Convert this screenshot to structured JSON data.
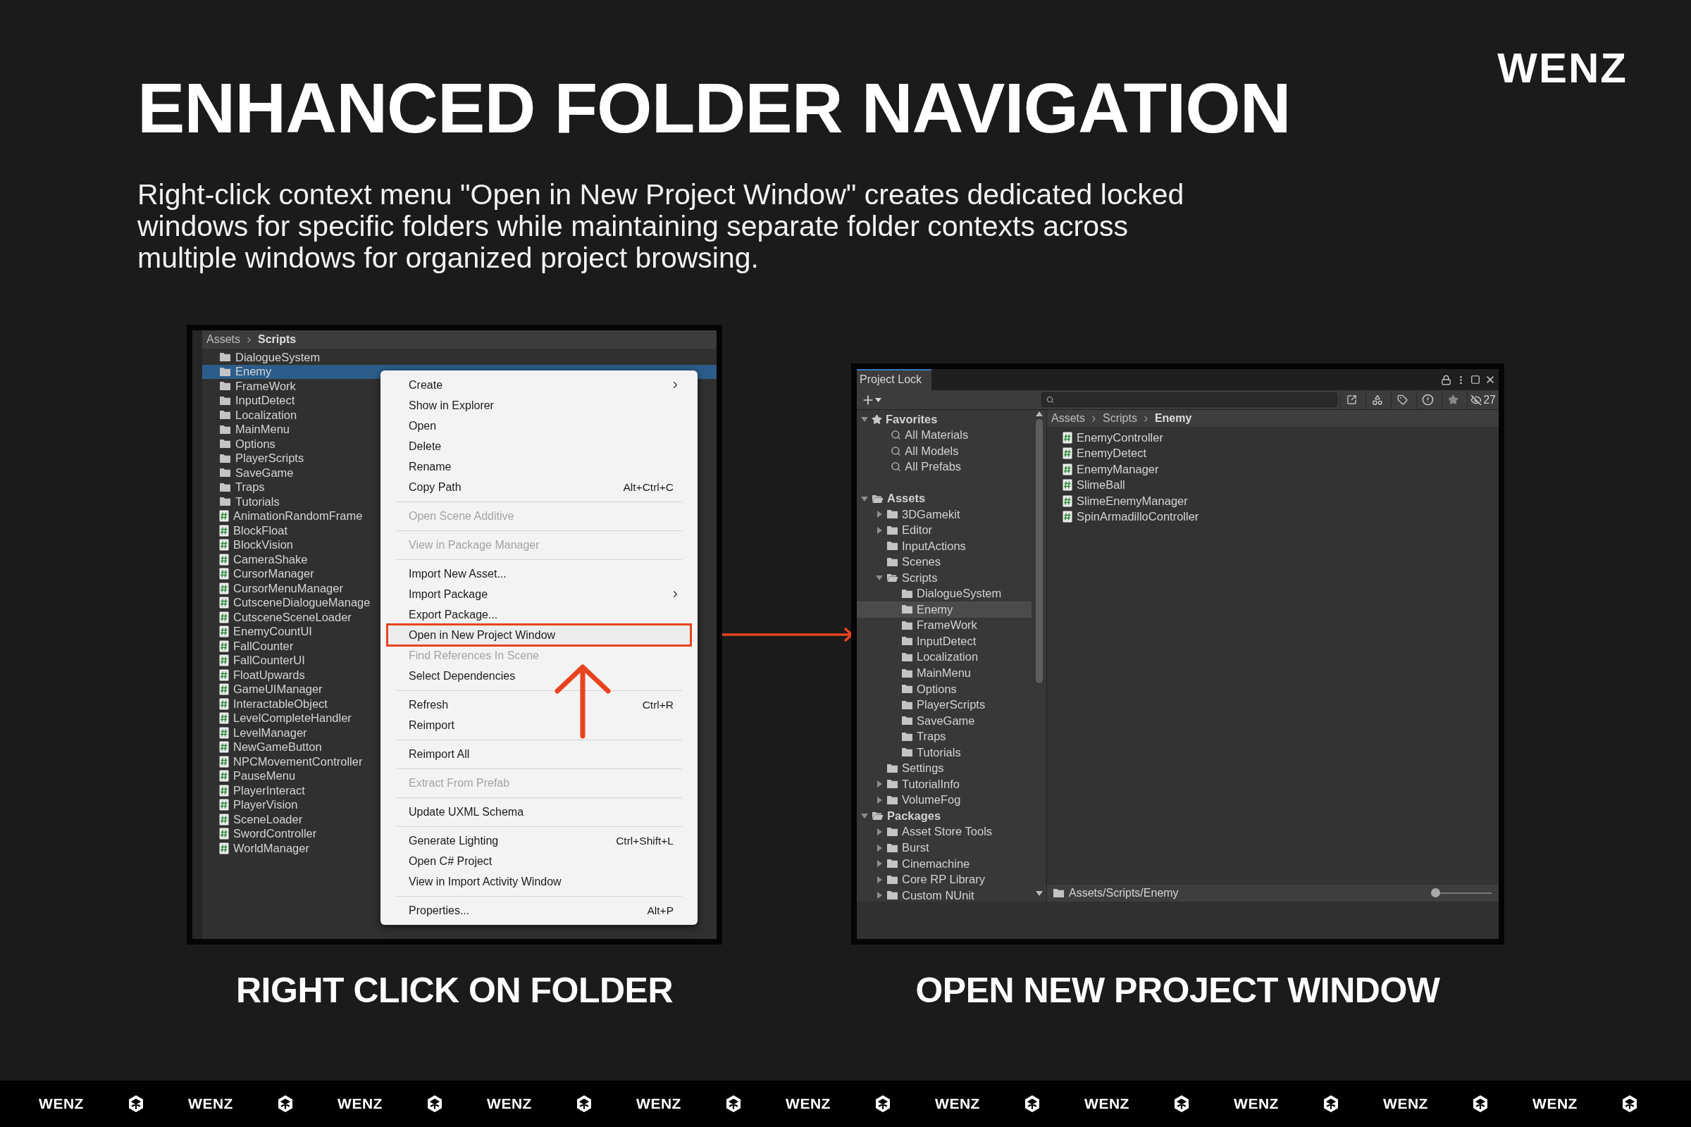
{
  "header": {
    "title": "ENHANCED FOLDER NAVIGATION",
    "description": "Right-click context menu \"Open in New Project Window\" creates dedicated locked windows for specific folders while maintaining separate folder contexts across multiple windows for organized project browsing.",
    "logo": "WENZ"
  },
  "left_panel": {
    "breadcrumb": [
      "Assets",
      "Scripts"
    ],
    "items": [
      {
        "name": "DialogueSystem",
        "kind": "folder",
        "selected": false
      },
      {
        "name": "Enemy",
        "kind": "folder",
        "selected": true
      },
      {
        "name": "FrameWork",
        "kind": "folder",
        "selected": false
      },
      {
        "name": "InputDetect",
        "kind": "folder",
        "selected": false
      },
      {
        "name": "Localization",
        "kind": "folder",
        "selected": false
      },
      {
        "name": "MainMenu",
        "kind": "folder",
        "selected": false
      },
      {
        "name": "Options",
        "kind": "folder",
        "selected": false
      },
      {
        "name": "PlayerScripts",
        "kind": "folder",
        "selected": false
      },
      {
        "name": "SaveGame",
        "kind": "folder",
        "selected": false
      },
      {
        "name": "Traps",
        "kind": "folder",
        "selected": false
      },
      {
        "name": "Tutorials",
        "kind": "folder",
        "selected": false
      },
      {
        "name": "AnimationRandomFrame",
        "kind": "script",
        "selected": false
      },
      {
        "name": "BlockFloat",
        "kind": "script",
        "selected": false
      },
      {
        "name": "BlockVision",
        "kind": "script",
        "selected": false
      },
      {
        "name": "CameraShake",
        "kind": "script",
        "selected": false
      },
      {
        "name": "CursorManager",
        "kind": "script",
        "selected": false
      },
      {
        "name": "CursorMenuManager",
        "kind": "script",
        "selected": false
      },
      {
        "name": "CutsceneDialogueManage",
        "kind": "script",
        "selected": false
      },
      {
        "name": "CutsceneSceneLoader",
        "kind": "script",
        "selected": false
      },
      {
        "name": "EnemyCountUI",
        "kind": "script",
        "selected": false
      },
      {
        "name": "FallCounter",
        "kind": "script",
        "selected": false
      },
      {
        "name": "FallCounterUI",
        "kind": "script",
        "selected": false
      },
      {
        "name": "FloatUpwards",
        "kind": "script",
        "selected": false
      },
      {
        "name": "GameUIManager",
        "kind": "script",
        "selected": false
      },
      {
        "name": "InteractableObject",
        "kind": "script",
        "selected": false
      },
      {
        "name": "LevelCompleteHandler",
        "kind": "script",
        "selected": false
      },
      {
        "name": "LevelManager",
        "kind": "script",
        "selected": false
      },
      {
        "name": "NewGameButton",
        "kind": "script",
        "selected": false
      },
      {
        "name": "NPCMovementController",
        "kind": "script",
        "selected": false
      },
      {
        "name": "PauseMenu",
        "kind": "script",
        "selected": false
      },
      {
        "name": "PlayerInteract",
        "kind": "script",
        "selected": false
      },
      {
        "name": "PlayerVision",
        "kind": "script",
        "selected": false
      },
      {
        "name": "SceneLoader",
        "kind": "script",
        "selected": false
      },
      {
        "name": "SwordController",
        "kind": "script",
        "selected": false
      },
      {
        "name": "WorldManager",
        "kind": "script",
        "selected": false
      }
    ],
    "context_menu": [
      [
        {
          "label": "Create",
          "disabled": false,
          "submenu": true,
          "highlighted": false
        },
        {
          "label": "Show in Explorer",
          "disabled": false,
          "submenu": false,
          "highlighted": false
        },
        {
          "label": "Open",
          "disabled": false,
          "submenu": false,
          "highlighted": false
        },
        {
          "label": "Delete",
          "disabled": false,
          "submenu": false,
          "highlighted": false
        },
        {
          "label": "Rename",
          "disabled": false,
          "submenu": false,
          "highlighted": false
        },
        {
          "label": "Copy Path",
          "shortcut": "Alt+Ctrl+C",
          "disabled": false,
          "submenu": false,
          "highlighted": false
        }
      ],
      [
        {
          "label": "Open Scene Additive",
          "disabled": true,
          "submenu": false,
          "highlighted": false
        }
      ],
      [
        {
          "label": "View in Package Manager",
          "disabled": true,
          "submenu": false,
          "highlighted": false
        }
      ],
      [
        {
          "label": "Import New Asset...",
          "disabled": false,
          "submenu": false,
          "highlighted": false
        },
        {
          "label": "Import Package",
          "disabled": false,
          "submenu": true,
          "highlighted": false
        },
        {
          "label": "Export Package...",
          "disabled": false,
          "submenu": false,
          "highlighted": false
        },
        {
          "label": "Open in New Project Window",
          "disabled": false,
          "submenu": false,
          "highlighted": true
        },
        {
          "label": "Find References In Scene",
          "disabled": true,
          "submenu": false,
          "highlighted": false
        },
        {
          "label": "Select Dependencies",
          "disabled": false,
          "submenu": false,
          "highlighted": false
        }
      ],
      [
        {
          "label": "Refresh",
          "shortcut": "Ctrl+R",
          "disabled": false,
          "submenu": false,
          "highlighted": false
        },
        {
          "label": "Reimport",
          "disabled": false,
          "submenu": false,
          "highlighted": false
        }
      ],
      [
        {
          "label": "Reimport All",
          "disabled": false,
          "submenu": false,
          "highlighted": false
        }
      ],
      [
        {
          "label": "Extract From Prefab",
          "disabled": true,
          "submenu": false,
          "highlighted": false
        }
      ],
      [
        {
          "label": "Update UXML Schema",
          "disabled": false,
          "submenu": false,
          "highlighted": false
        }
      ],
      [
        {
          "label": "Generate Lighting",
          "shortcut": "Ctrl+Shift+L",
          "disabled": false,
          "submenu": false,
          "highlighted": false
        },
        {
          "label": "Open C# Project",
          "disabled": false,
          "submenu": false,
          "highlighted": false
        },
        {
          "label": "View in Import Activity Window",
          "disabled": false,
          "submenu": false,
          "highlighted": false
        }
      ],
      [
        {
          "label": "Properties...",
          "shortcut": "Alt+P",
          "disabled": false,
          "submenu": false,
          "highlighted": false
        }
      ]
    ],
    "caption": "RIGHT CLICK ON FOLDER"
  },
  "right_panel": {
    "window": {
      "tab_title": "Project Lock",
      "hidden_count": "27",
      "tree": [
        {
          "name": "Favorites",
          "kind": "favorites",
          "expanded": true,
          "selected": false,
          "children": [
            {
              "name": "All Materials",
              "kind": "search",
              "selected": false
            },
            {
              "name": "All Models",
              "kind": "search",
              "selected": false
            },
            {
              "name": "All Prefabs",
              "kind": "search",
              "selected": false
            }
          ]
        },
        {
          "name": "Assets",
          "kind": "root",
          "expanded": true,
          "selected": false,
          "children": [
            {
              "name": "3DGamekit",
              "kind": "folder",
              "expanded": false,
              "selected": false
            },
            {
              "name": "Editor",
              "kind": "folder",
              "expanded": false,
              "selected": false
            },
            {
              "name": "InputActions",
              "kind": "folder",
              "selected": false
            },
            {
              "name": "Scenes",
              "kind": "folder",
              "selected": false
            },
            {
              "name": "Scripts",
              "kind": "folder",
              "expanded": true,
              "selected": false,
              "children": [
                {
                  "name": "DialogueSystem",
                  "kind": "folder",
                  "selected": false
                },
                {
                  "name": "Enemy",
                  "kind": "folder",
                  "selected": true
                },
                {
                  "name": "FrameWork",
                  "kind": "folder",
                  "selected": false
                },
                {
                  "name": "InputDetect",
                  "kind": "folder",
                  "selected": false
                },
                {
                  "name": "Localization",
                  "kind": "folder",
                  "selected": false
                },
                {
                  "name": "MainMenu",
                  "kind": "folder",
                  "selected": false
                },
                {
                  "name": "Options",
                  "kind": "folder",
                  "selected": false
                },
                {
                  "name": "PlayerScripts",
                  "kind": "folder",
                  "selected": false
                },
                {
                  "name": "SaveGame",
                  "kind": "folder",
                  "selected": false
                },
                {
                  "name": "Traps",
                  "kind": "folder",
                  "selected": false
                },
                {
                  "name": "Tutorials",
                  "kind": "folder",
                  "selected": false
                }
              ]
            },
            {
              "name": "Settings",
              "kind": "folder",
              "selected": false
            },
            {
              "name": "TutorialInfo",
              "kind": "folder",
              "expanded": false,
              "selected": false
            },
            {
              "name": "VolumeFog",
              "kind": "folder",
              "expanded": false,
              "selected": false
            }
          ]
        },
        {
          "name": "Packages",
          "kind": "root",
          "expanded": true,
          "selected": false,
          "children": [
            {
              "name": "Asset Store Tools",
              "kind": "folder",
              "expanded": false,
              "selected": false
            },
            {
              "name": "Burst",
              "kind": "folder",
              "expanded": false,
              "selected": false
            },
            {
              "name": "Cinemachine",
              "kind": "folder",
              "expanded": false,
              "selected": false
            },
            {
              "name": "Core RP Library",
              "kind": "folder",
              "expanded": false,
              "selected": false
            },
            {
              "name": "Custom NUnit",
              "kind": "folder",
              "expanded": false,
              "selected": false
            }
          ]
        }
      ],
      "breadcrumb": [
        "Assets",
        "Scripts",
        "Enemy"
      ],
      "files": [
        "EnemyController",
        "EnemyDetect",
        "EnemyManager",
        "SlimeBall",
        "SlimeEnemyManager",
        "SpinArmadilloController"
      ],
      "footer_path": "Assets/Scripts/Enemy",
      "zoom_slider": {
        "level": 0
      }
    },
    "caption": "OPEN NEW PROJECT WINDOW"
  },
  "footer_bar": [
    "WENZ",
    "WENZ",
    "WENZ",
    "WENZ",
    "WENZ",
    "WENZ",
    "WENZ",
    "WENZ",
    "WENZ",
    "WENZ",
    "WENZ"
  ]
}
